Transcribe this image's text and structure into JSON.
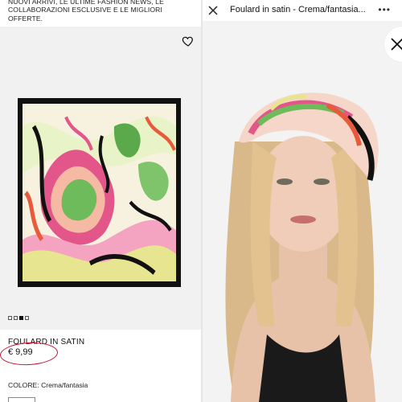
{
  "promo": {
    "text": "NUOVI ARRIVI, LE ULTIME FASHION NEWS, LE COLLABORAZIONI ESCLUSIVE E LE MIGLIORI OFFERTE."
  },
  "gallery": {
    "image_count": 4,
    "active_index": 2
  },
  "product": {
    "name": "FOULARD IN SATIN",
    "price": "€ 9,99",
    "color_label": "COLORE: Crema/fantasia"
  },
  "viewer": {
    "title": "Foulard in satin - Crema/fantasia...",
    "more": "•••"
  },
  "colors": {
    "accent_ring": "#c8102e",
    "scarf_border": "#111111"
  }
}
